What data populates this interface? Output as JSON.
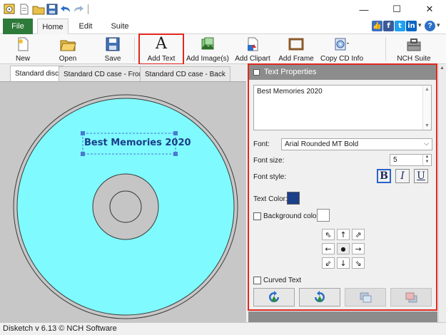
{
  "window": {
    "minimize_glyph": "—",
    "maximize_glyph": "☐",
    "close_glyph": "✕"
  },
  "ribbon_tabs": {
    "file": "File",
    "home": "Home",
    "edit": "Edit",
    "suite": "Suite"
  },
  "help": {
    "social": [
      "thumbs-up-icon",
      "facebook-icon",
      "twitter-icon",
      "linkedin-icon"
    ],
    "info_glyph": "▾",
    "help_glyph": "?",
    "help_chevron": "▾"
  },
  "toolbar": {
    "new": "New",
    "open": "Open",
    "save": "Save",
    "add_text": "Add Text",
    "add_images": "Add Image(s)",
    "add_clipart": "Add Clipart",
    "add_frame": "Add Frame",
    "copy_cd_info": "Copy CD Info",
    "nch_suite": "NCH Suite",
    "add_text_glyph": "A"
  },
  "doc_tabs": [
    "Standard disc",
    "Standard CD case - Front",
    "Standard CD case - Back"
  ],
  "canvas": {
    "disc_text": "Best Memories 2020",
    "disc_color": "#7ffaff"
  },
  "text_properties": {
    "header": "Text Properties",
    "text_value": "Best Memories 2020",
    "font_label": "Font:",
    "font_value": "Arial Rounded MT Bold",
    "font_size_label": "Font size:",
    "font_size_value": "5",
    "font_style_label": "Font style:",
    "bold_glyph": "B",
    "italic_glyph": "I",
    "underline_glyph": "U",
    "text_color_label": "Text Color:",
    "text_color": "#1c3f8a",
    "background_color_label": "Background color:",
    "curved_text_label": "Curved Text",
    "align_glyphs": [
      "⇖",
      "↑",
      "⇗",
      "←",
      "●",
      "→",
      "⇙",
      "↓",
      "⇘"
    ]
  },
  "status": {
    "text": "Disketch v 6.13 © NCH Software"
  },
  "colors": {
    "accent_red": "#e0281e",
    "file_tab": "#2e7a3a",
    "panel_header": "#8c8c8c"
  }
}
